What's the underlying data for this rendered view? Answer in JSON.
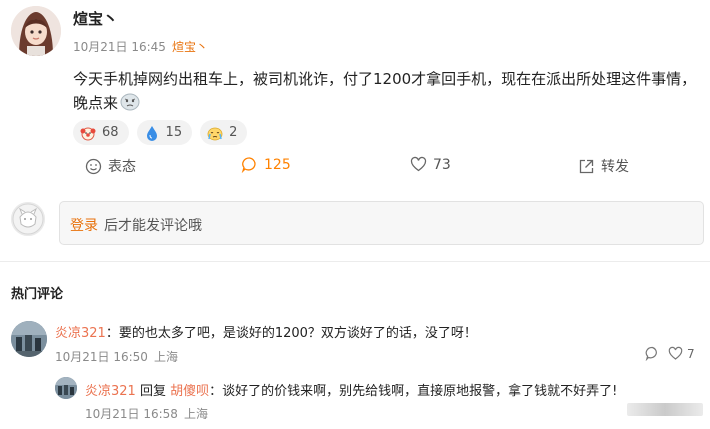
{
  "post": {
    "author": "煊宝丶",
    "date": "10月21日 16:45",
    "source": "煊宝丶",
    "text": "今天手机掉网约出租车上，被司机讹诈，付了1200才拿回手机，现在在派出所处理这件事情，晚点来",
    "emoji": "sad-face-icon",
    "reactions": [
      {
        "icon": "clown-icon",
        "count": "68"
      },
      {
        "icon": "water-drop-icon",
        "count": "15"
      },
      {
        "icon": "tearful-face-icon",
        "count": "2"
      }
    ]
  },
  "actions": {
    "emote": "表态",
    "comments": "125",
    "likes": "73",
    "repost": "转发"
  },
  "comment_box": {
    "login": "登录",
    "hint": "后才能发评论哦"
  },
  "section_title": "热门评论",
  "comments": [
    {
      "user": "炎凉321",
      "separator": "：",
      "text": "要的也太多了吧，是谈好的1200？双方谈好了的话，没了呀！",
      "date": "10月21日 16:50",
      "location": "上海",
      "likes": "7"
    }
  ],
  "replies": [
    {
      "user": "炎凉321",
      "reply_word": "回复",
      "target": "胡傻呗",
      "separator": "：",
      "text": "谈好了的价钱来啊，别先给钱啊，直接原地报警，拿了钱就不好弄了!",
      "date": "10月21日 16:58",
      "location": "上海"
    }
  ],
  "colors": {
    "accent": "#ff8200",
    "username": "#eb7350",
    "link": "#e8720c"
  }
}
